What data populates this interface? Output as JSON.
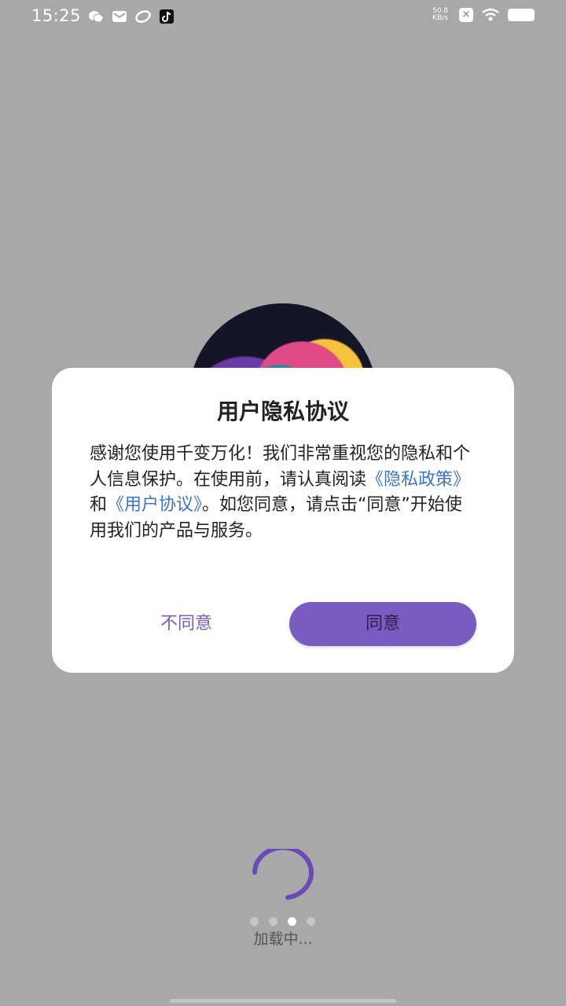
{
  "status_bar": {
    "time": "15:25",
    "network_speed_value": "50.8",
    "network_speed_unit": "KB/s",
    "icons": [
      "wechat-icon",
      "mail-icon",
      "app-icon",
      "tiktok-icon",
      "close-box-icon",
      "wifi-icon",
      "battery-icon"
    ]
  },
  "dialog": {
    "title": "用户隐私协议",
    "body_text_1": "感谢您使用千变万化！我们非常重视您的隐私和个人信息保护。在使用前，请认真阅读",
    "privacy_link": "《隐私政策》",
    "body_text_2": "和",
    "agreement_link": "《用户协议》",
    "body_text_3": "。如您同意，请点击“同意”开始使用我们的产品与服务。",
    "decline_label": "不同意",
    "agree_label": "同意"
  },
  "loading": {
    "text": "加载中...",
    "dot_count": 4,
    "active_dot_index": 2
  },
  "colors": {
    "accent": "#7a5cc0",
    "link": "#3c74c8",
    "background_overlay": "#a8a8a8"
  }
}
